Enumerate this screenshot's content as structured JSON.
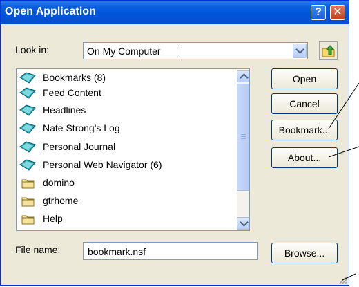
{
  "window": {
    "title": "Open Application",
    "help_label": "?",
    "close_label": "✕"
  },
  "look_in": {
    "label": "Look in:",
    "value": "On My Computer"
  },
  "icons": {
    "database": "database-icon",
    "folder": "folder-icon",
    "up_folder": "up-one-level-icon"
  },
  "files": [
    {
      "label": "Bookmarks (8)",
      "icon": "database-icon",
      "selected": true
    },
    {
      "label": "Feed Content",
      "icon": "database-icon"
    },
    {
      "label": "Headlines",
      "icon": "database-icon"
    },
    {
      "label": "Nate Strong's Log",
      "icon": "database-icon"
    },
    {
      "label": "Personal Journal",
      "icon": "database-icon"
    },
    {
      "label": "Personal Web Navigator (6)",
      "icon": "database-icon"
    },
    {
      "label": "domino",
      "icon": "folder-icon"
    },
    {
      "label": "gtrhome",
      "icon": "folder-icon"
    },
    {
      "label": "Help",
      "icon": "folder-icon"
    }
  ],
  "buttons": {
    "open": "Open",
    "cancel": "Cancel",
    "bookmark": "Bookmark...",
    "about": "About...",
    "browse": "Browse..."
  },
  "file_name": {
    "label": "File name:",
    "value": "bookmark.nsf"
  },
  "colors": {
    "titlebar": "#0054e3",
    "dialog_bg": "#ece9d8",
    "border": "#7f9db9"
  }
}
